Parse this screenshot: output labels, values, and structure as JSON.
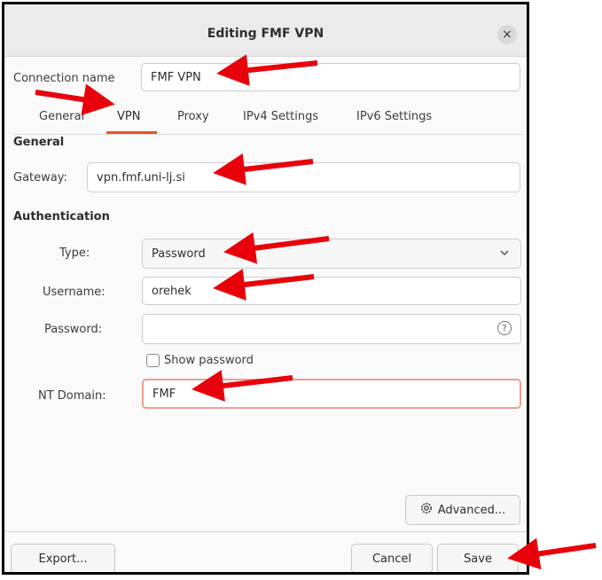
{
  "window": {
    "title": "Editing FMF VPN",
    "close_glyph": "×"
  },
  "connection": {
    "label": "Connection name",
    "value": "FMF VPN"
  },
  "tabs": [
    {
      "label": "General"
    },
    {
      "label": "VPN"
    },
    {
      "label": "Proxy"
    },
    {
      "label": "IPv4 Settings"
    },
    {
      "label": "IPv6 Settings"
    }
  ],
  "active_tab": "VPN",
  "general": {
    "heading": "General",
    "gateway_label": "Gateway:",
    "gateway_value": "vpn.fmf.uni-lj.si"
  },
  "authentication": {
    "heading": "Authentication",
    "type_label": "Type:",
    "type_value": "Password",
    "username_label": "Username:",
    "username_value": "orehek",
    "password_label": "Password:",
    "password_value": "",
    "password_hint_glyph": "?",
    "show_password_label": "Show password",
    "ntdomain_label": "NT Domain:",
    "ntdomain_value": "FMF"
  },
  "buttons": {
    "advanced": "Advanced...",
    "export": "Export...",
    "cancel": "Cancel",
    "save": "Save"
  },
  "icons": {
    "close": "close-icon",
    "dropdown": "chevron-down-icon",
    "hint": "question-circle-icon",
    "advanced": "gear-icon",
    "annotation": "red-arrow-icon"
  },
  "colors": {
    "accent": "#e95420",
    "annotation_arrow": "#e8000b",
    "focus_border": "#e9a191"
  }
}
